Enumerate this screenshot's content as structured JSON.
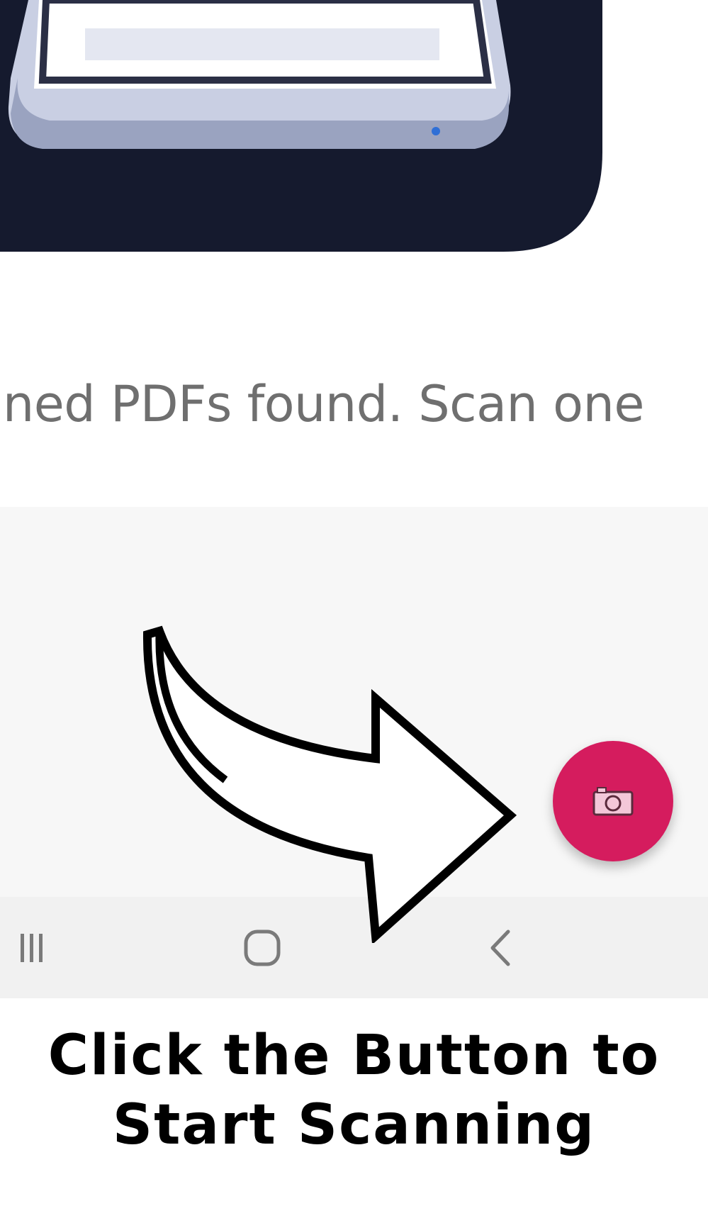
{
  "empty_state": {
    "message": "nned PDFs found. Scan one"
  },
  "fab": {
    "icon": "camera-icon",
    "color": "#d51c5e"
  },
  "nav_bar": {
    "recents_icon": "recents-icon",
    "home_icon": "home-icon",
    "back_icon": "back-icon"
  },
  "caption": {
    "line1": "Click the Button to",
    "line2": "Start Scanning"
  }
}
